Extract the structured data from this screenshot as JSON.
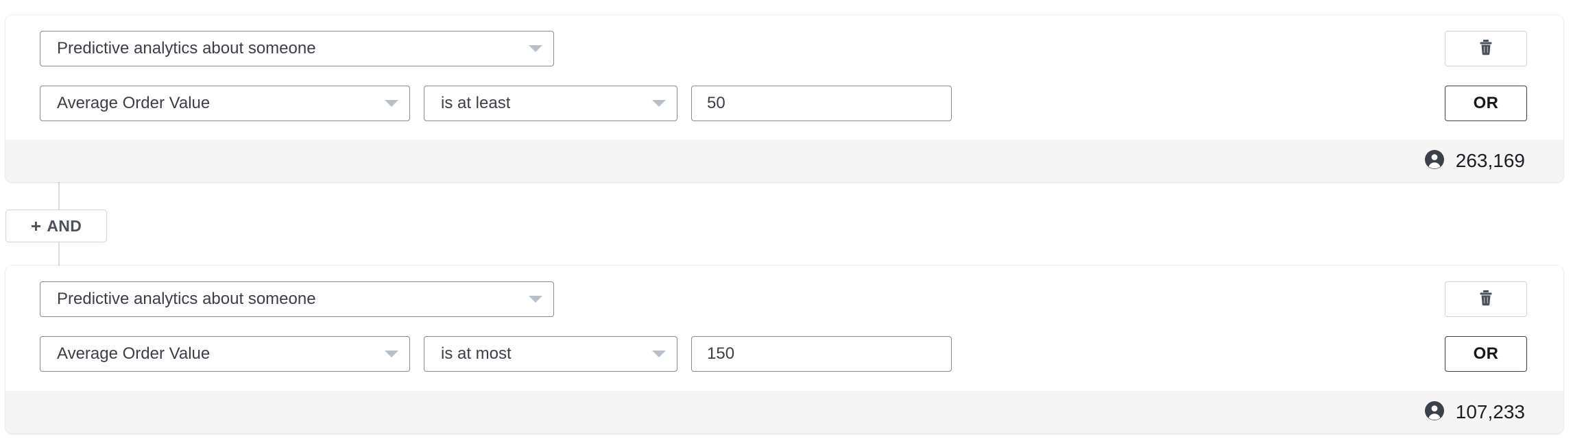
{
  "builder": {
    "groups": [
      {
        "subject": {
          "label": "Predictive analytics about someone",
          "icon": "chevron-down-icon"
        },
        "attribute": {
          "label": "Average Order Value",
          "icon": "chevron-down-icon"
        },
        "operator": {
          "label": "is at least",
          "icon": "chevron-down-icon"
        },
        "value": {
          "text": "50",
          "placeholder": "Enter a value"
        },
        "delete": {
          "icon": "trash-icon",
          "label": ""
        },
        "or": {
          "label": "OR"
        },
        "count": {
          "icon": "person-icon",
          "value": "263,169"
        }
      },
      {
        "subject": {
          "label": "Predictive analytics about someone",
          "icon": "chevron-down-icon"
        },
        "attribute": {
          "label": "Average Order Value",
          "icon": "chevron-down-icon"
        },
        "operator": {
          "label": "is at most",
          "icon": "chevron-down-icon"
        },
        "value": {
          "text": "150",
          "placeholder": "Enter a value"
        },
        "delete": {
          "icon": "trash-icon",
          "label": ""
        },
        "or": {
          "label": "OR"
        },
        "count": {
          "icon": "person-icon",
          "value": "107,233"
        }
      }
    ],
    "and_button": {
      "icon": "plus-icon",
      "plus_glyph": "+",
      "label": "AND"
    },
    "colors": {
      "card_background": "#ffffff",
      "footer_background": "#f5f5f5",
      "control_border": "#8a8a8a",
      "caret": "#b9bfc7",
      "text": "#3b3f45",
      "or_border": "#3c4043",
      "connector": "#dddddd"
    }
  }
}
